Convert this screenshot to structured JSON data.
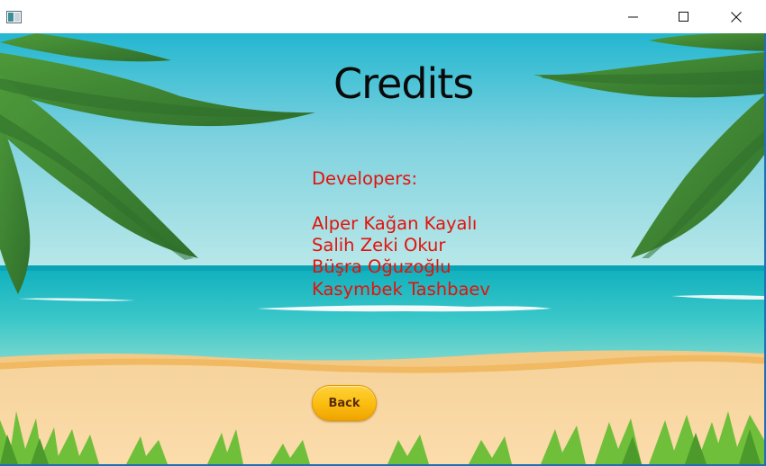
{
  "window": {
    "title": "",
    "controls": {
      "minimize": "minimize-icon",
      "maximize": "maximize-icon",
      "close": "close-icon"
    }
  },
  "credits": {
    "title": "Credits",
    "developers_heading": "Developers:",
    "developers": [
      "Alper Kağan Kayalı",
      "Salih Zeki Okur",
      "Büşra Oğuzoğlu",
      "Kasymbek Tashbaev"
    ],
    "back_label": "Back"
  },
  "colors": {
    "title_text": "#0a0a0a",
    "credits_text": "#e3120b",
    "button_yellow": "#fbbf12",
    "button_text": "#5a2c06",
    "sky": "#2bbdd3",
    "sea": "#18b8c0",
    "sand": "#f9d8a2",
    "frame_border": "#1f6fb5"
  },
  "icons": {
    "app": "app-window-icon",
    "background": "beach-palm-scene"
  }
}
